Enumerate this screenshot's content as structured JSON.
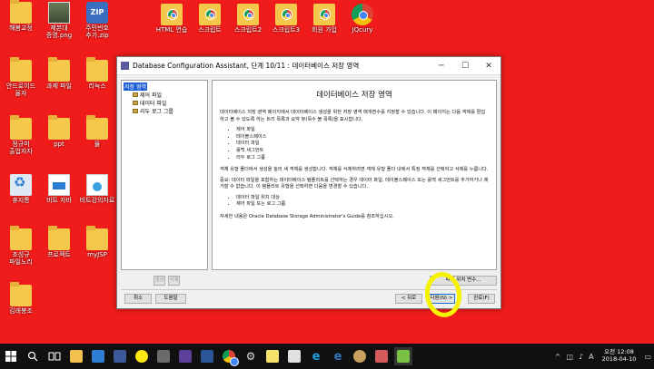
{
  "desktop": {
    "icons": [
      {
        "label": "해봄교정",
        "type": "folder",
        "pos": 0
      },
      {
        "label": "제본대\n증명.png",
        "type": "photo",
        "pos": 1
      },
      {
        "label": "주민번호\n추가.zip",
        "type": "zip",
        "pos": 2
      },
      {
        "label": "HTML 연습",
        "type": "chrome",
        "pos": 3
      },
      {
        "label": "스크립트",
        "type": "chrome",
        "pos": 4
      },
      {
        "label": "스크립트2",
        "type": "chrome",
        "pos": 5
      },
      {
        "label": "스크립트3",
        "type": "chrome",
        "pos": 6
      },
      {
        "label": "회원 가입",
        "type": "chrome",
        "pos": 7
      },
      {
        "label": "JQcury",
        "type": "chrome-app",
        "pos": 8
      },
      {
        "label": "안드로이드\n율자",
        "type": "folder",
        "pos": 9
      },
      {
        "label": "과제 파일",
        "type": "folder",
        "pos": 10
      },
      {
        "label": "리눅스",
        "type": "folder",
        "pos": 11
      },
      {
        "label": "정규미\n출업자자",
        "type": "folder",
        "pos": 12
      },
      {
        "label": "ppt",
        "type": "folder",
        "pos": 13
      },
      {
        "label": "물",
        "type": "folder",
        "pos": 14
      },
      {
        "label": "휴지통",
        "type": "recycle",
        "pos": 15
      },
      {
        "label": "비트 자바",
        "type": "doc",
        "pos": 16
      },
      {
        "label": "비트강의자료",
        "type": "doc-blue",
        "pos": 17
      },
      {
        "label": "조성규\n파일노리",
        "type": "folder",
        "pos": 18
      },
      {
        "label": "프로젝트",
        "type": "folder",
        "pos": 19
      },
      {
        "label": "myJSP",
        "type": "folder",
        "pos": 20
      },
      {
        "label": "김래봉조",
        "type": "folder",
        "pos": 21
      }
    ]
  },
  "window": {
    "title": "Database Configuration Assistant, 단계 10/11 : 데이터베이스 저장 영역",
    "minimize": "─",
    "maximize": "☐",
    "close": "✕",
    "tree": {
      "root": "저장 영역",
      "children": [
        "제어 파일",
        "데이터 파일",
        "리두 로그 그룹"
      ]
    },
    "content": {
      "heading": "데이터베이스 저장 영역",
      "para1": "데이터베이스 저장 영역 페이지에서 데이터베이스 생성을 위한 저장 영역 매개변수를 지정할 수 있습니다. 이 페이지는 다음 객체를 편집하고 볼 수 있도록 하는 트리 목록과 요약 뷰(목수 볼 목록)을 표시합니다.",
      "list1": [
        "제어 파일",
        "테이블스페이스",
        "데이터 파일",
        "롤백 세그먼트",
        "리두 로그 그룹"
      ],
      "para2": "객체 유형 폴더에서 생성을 눌러 새 객체를 생성합니다. 객체를 삭제하려면 객체 유형 폴더 내에서 특정 객체를 선택하고 삭제를 누릅니다.",
      "para3": "중요: 데이터 파일을 포함하는 데이터베이스 템플리트를 선택하는 경우 데이터 파일, 테이블스페이스 또는 롤백 세그먼트를 추가하거나 제거할 수 없습니다. 이 템플리트 유형을 선택하면 다음을 변경할 수 있습니다.",
      "list2": [
        "데이터 파일 위치 대상",
        "제어 파일 또는 로그 그룹"
      ],
      "para4": "자세한 내용은 Oracle Database Storage Administrator's Guide를 참조하십시오."
    },
    "buttons": {
      "create": "생성",
      "delete": "삭제",
      "file_location_vars": "파일 위치 변수...",
      "cancel": "취소",
      "help": "도움말",
      "back": "< 뒤로",
      "next": "다음(N) >",
      "finish": "완료(F)"
    }
  },
  "taskbar": {
    "items": [
      "windows-logo",
      "search",
      "task-view",
      "file-explorer",
      "store",
      "calendar-2017",
      "kakaotalk",
      "media",
      "ae-app",
      "word",
      "chrome",
      "settings",
      "sticky",
      "paint",
      "ie",
      "edge",
      "shell",
      "ribbon",
      "dev-app"
    ],
    "tray": {
      "time": "오전 12:08",
      "date": "2018-04-10",
      "ime": "A"
    }
  }
}
